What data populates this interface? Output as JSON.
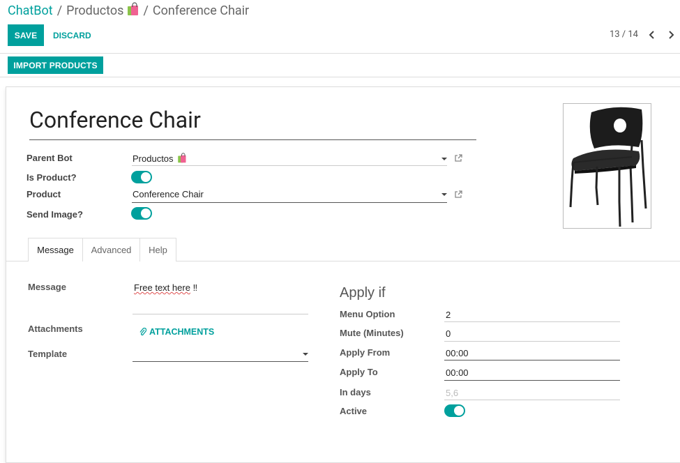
{
  "breadcrumb": {
    "root": "ChatBot",
    "middle": "Productos",
    "current": "Conference Chair"
  },
  "control_panel": {
    "save_label": "SAVE",
    "discard_label": "DISCARD",
    "pager": "13 / 14",
    "import_label": "IMPORT PRODUCTS"
  },
  "record": {
    "name": "Conference Chair",
    "fields": {
      "parent_bot_label": "Parent Bot",
      "parent_bot_value": "Productos",
      "is_product_label": "Is Product?",
      "is_product": true,
      "product_label": "Product",
      "product_value": "Conference Chair",
      "send_image_label": "Send Image?",
      "send_image": true
    }
  },
  "tabs": [
    {
      "label": "Message",
      "active": true
    },
    {
      "label": "Advanced",
      "active": false
    },
    {
      "label": "Help",
      "active": false
    }
  ],
  "message_tab": {
    "message_label": "Message",
    "message_value_a": "Free text here",
    "message_value_b": "‼",
    "attachments_label": "Attachments",
    "attachments_button": "ATTACHMENTS",
    "template_label": "Template",
    "template_value": ""
  },
  "apply_if": {
    "title": "Apply if",
    "menu_option_label": "Menu Option",
    "menu_option_value": "2",
    "mute_label": "Mute (Minutes)",
    "mute_value": "0",
    "apply_from_label": "Apply From",
    "apply_from_value": "00:00",
    "apply_to_label": "Apply To",
    "apply_to_value": "00:00",
    "in_days_label": "In days",
    "in_days_placeholder": "5,6",
    "active_label": "Active",
    "active": true
  },
  "colors": {
    "accent": "#00A09D",
    "text": "#4c4c4c"
  }
}
